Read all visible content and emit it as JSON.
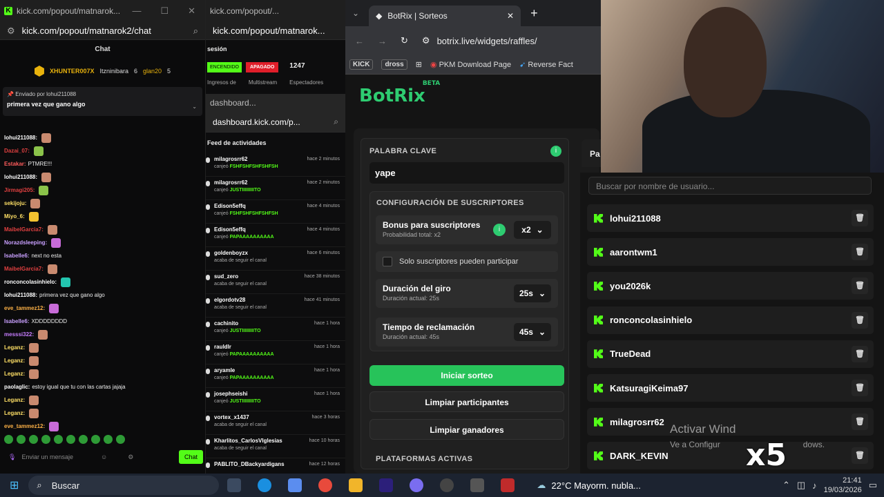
{
  "chat_window": {
    "tab_title": "kick.com/popout/matnarok...",
    "url": "kick.com/popout/matnarok2/chat",
    "header": "Chat",
    "gifters": [
      {
        "name": "XHUNTER007X",
        "count": "7"
      },
      {
        "name": "Itzninibara",
        "count": "6"
      },
      {
        "name": "glan20",
        "count": "5"
      }
    ],
    "pinned_by": "Enviado por",
    "pinned_user": "lohui211088",
    "pinned_message": "primera vez que gano algo",
    "messages": [
      {
        "user": "lohui211088:",
        "text": "",
        "color": "#ffffff"
      },
      {
        "user": "Dazai_07:",
        "text": "",
        "color": "#e04040"
      },
      {
        "user": "Estakar:",
        "text": "PTMRE!!!",
        "color": "#ff5c5c"
      },
      {
        "user": "lohui211088:",
        "text": "",
        "color": "#ffffff"
      },
      {
        "user": "Jirmagi205:",
        "text": "",
        "color": "#e04040"
      },
      {
        "user": "sekijoju:",
        "text": "",
        "color": "#ffe066"
      },
      {
        "user": "Miyo_6:",
        "text": "",
        "color": "#ffe066"
      },
      {
        "user": "MaibelGarcia7:",
        "text": "",
        "color": "#e04040"
      },
      {
        "user": "Norazdsleeping:",
        "text": "",
        "color": "#c9a0ff"
      },
      {
        "user": "Isabelle6:",
        "text": "next no esta",
        "color": "#c9a0ff"
      },
      {
        "user": "MaibelGarcia7:",
        "text": "",
        "color": "#e04040"
      },
      {
        "user": "ronconcolasinhielo:",
        "text": "",
        "color": "#ffffff"
      },
      {
        "user": "lohui211088:",
        "text": "primera vez que gano algo",
        "color": "#ffffff"
      },
      {
        "user": "eve_tammez12:",
        "text": "",
        "color": "#ffb347"
      },
      {
        "user": "Isabelle6:",
        "text": "XDDDDDDDD",
        "color": "#c9a0ff"
      },
      {
        "user": "messsi322:",
        "text": "",
        "color": "#c77dff"
      },
      {
        "user": "Leganz:",
        "text": "",
        "color": "#ffe066"
      },
      {
        "user": "Leganz:",
        "text": "",
        "color": "#ffe066"
      },
      {
        "user": "Leganz:",
        "text": "",
        "color": "#ffe066"
      },
      {
        "user": "paolaglic:",
        "text": "estoy igual que tu con las cartas jajaja",
        "color": "#ffffff"
      },
      {
        "user": "Leganz:",
        "text": "",
        "color": "#ffe066"
      },
      {
        "user": "Leganz:",
        "text": "",
        "color": "#ffe066"
      },
      {
        "user": "eve_tammez12:",
        "text": "",
        "color": "#ffb347"
      }
    ],
    "input_placeholder": "Enviar un mensaje",
    "send_label": "Chat"
  },
  "dashboard_window": {
    "tab_title": "kick.com/popout/...",
    "url": "kick.com/popout/matnarok...",
    "section": "sesión",
    "status_on": "ENCENDIDO",
    "status_off": "APAGADO",
    "viewers": "1247",
    "label_income": "Ingresos de",
    "label_multistream": "Multistream",
    "label_viewers": "Espectadores"
  },
  "feed_window": {
    "tab_title": "dashboard...",
    "url": "dashboard.kick.com/p...",
    "title": "Feed de actividades",
    "items": [
      {
        "user": "milagrosrr62",
        "action": "canjeó",
        "reward": "FSHFSHFSHFSHFSH",
        "time": "hace 2 minutos"
      },
      {
        "user": "milagrosrr62",
        "action": "canjeó",
        "reward": "JUSTIIIIIIIIITO",
        "time": "hace 2 minutos"
      },
      {
        "user": "Edison5effq",
        "action": "canjeó",
        "reward": "FSHFSHFSHFSHFSH",
        "time": "hace 4 minutos"
      },
      {
        "user": "Edison5effq",
        "action": "canjeó",
        "reward": "PAPAAAAAAAAAA",
        "time": "hace 4 minutos"
      },
      {
        "user": "goldenboyzx",
        "action": "acaba de seguir el canal",
        "reward": "",
        "time": "hace 6 minutos"
      },
      {
        "user": "sud_zero",
        "action": "acaba de seguir el canal",
        "reward": "",
        "time": "hace 38 minutos"
      },
      {
        "user": "elgordotv28",
        "action": "acaba de seguir el canal",
        "reward": "",
        "time": "hace 41 minutos"
      },
      {
        "user": "cachinito",
        "action": "canjeó",
        "reward": "JUSTIIIIIIIIITO",
        "time": "hace 1 hora"
      },
      {
        "user": "rauldlr",
        "action": "canjeó",
        "reward": "PAPAAAAAAAAAA",
        "time": "hace 1 hora"
      },
      {
        "user": "aryamle",
        "action": "canjeó",
        "reward": "PAPAAAAAAAAAA",
        "time": "hace 1 hora"
      },
      {
        "user": "josephseishi",
        "action": "canjeó",
        "reward": "JUSTIIIIIIIIITO",
        "time": "hace 1 hora"
      },
      {
        "user": "vortex_x1437",
        "action": "acaba de seguir el canal",
        "reward": "",
        "time": "hace 3 horas"
      },
      {
        "user": "Kharlitos_CarlosVIglesias",
        "action": "acaba de seguir el canal",
        "reward": "",
        "time": "hace 10 horas"
      },
      {
        "user": "PABLITO_DBackyardigans",
        "action": "",
        "reward": "",
        "time": "hace 12 horas"
      }
    ]
  },
  "botrix_window": {
    "tab_title": "BotRix | Sorteos",
    "url": "botrix.live/widgets/raffles/",
    "bookmarks": [
      "KICK",
      "dross",
      "PKM Download Page",
      "Reverse Fact"
    ],
    "logo": "BotRix",
    "logo_badge": "BETA",
    "keyword_label": "PALABRA CLAVE",
    "keyword_value": "yape",
    "subs_config_label": "CONFIGURACIÓN DE SUSCRIPTORES",
    "bonus_title": "Bonus para suscriptores",
    "bonus_sub": "Probabilidad total: x2",
    "bonus_value": "x2",
    "subs_only_label": "Solo suscriptores pueden participar",
    "spin_title": "Duración del giro",
    "spin_sub": "Duración actual: 25s",
    "spin_value": "25s",
    "claim_title": "Tiempo de reclamación",
    "claim_sub": "Duración actual: 45s",
    "claim_value": "45s",
    "start_button": "Iniciar sorteo",
    "clear_participants": "Limpiar participantes",
    "clear_winners": "Limpiar ganadores",
    "platforms_label": "PLATAFORMAS ACTIVAS",
    "participants_tab": "Pa"
  },
  "participants": {
    "search_placeholder": "Buscar por nombre de usuario...",
    "list": [
      "lohui211088",
      "aarontwm1",
      "you2026k",
      "ronconcolasinhielo",
      "TrueDead",
      "KatsuragiKeima97",
      "milagrosrr62",
      "DARK_KEVIN"
    ]
  },
  "overlay": {
    "activate_title": "Activar Wind",
    "activate_sub": "Ve a Configur",
    "activate_sub2": "dows.",
    "multiplier": "x5"
  },
  "taskbar": {
    "search": "Buscar",
    "weather": "22°C  Mayorm. nubla...",
    "time": "21:41",
    "date": "19/03/2026"
  }
}
